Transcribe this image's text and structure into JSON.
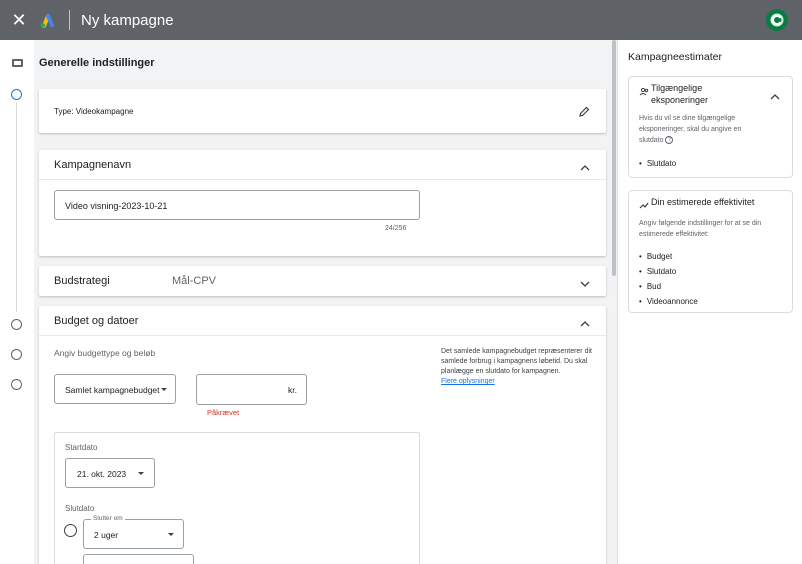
{
  "topbar": {
    "title": "Ny kampagne",
    "close_icon": "close-icon",
    "logo_icon": "google-ads-logo",
    "avatar_icon": "account-avatar"
  },
  "main": {
    "section_title": "Generelle indstillinger",
    "type_card": {
      "label": "Type: Videokampagne",
      "edit_icon": "pencil-icon"
    },
    "name_card": {
      "header": "Kampagnenavn",
      "value": "Video visning-2023-10-21",
      "counter": "24/256"
    },
    "bid_card": {
      "header": "Budstrategi",
      "value": "Mål-CPV"
    },
    "budget_card": {
      "header": "Budget og datoer",
      "prompt": "Angiv budgettype og beløb",
      "budget_type": "Samlet kampagnebudget",
      "amount_value": "",
      "currency": "kr.",
      "error": "Påkrævet",
      "help_text": "Det samlede kampagnebudget repræsenterer dit samlede forbrug i kampagnens løbetid. Du skal planlægge en slutdato for kampagnen.",
      "help_link": "Flere oplysninger",
      "start_label": "Startdato",
      "start_value": "21. okt. 2023",
      "end_label": "Slutdato",
      "ends_in_label": "Slutter om",
      "ends_in_value": "2 uger"
    }
  },
  "aside": {
    "title": "Kampagneestimater",
    "exposures": {
      "title": "Tilgængelige eksponeringer",
      "desc": "Hvis du vil se dine tilgængelige eksponeringer, skal du angive en slutdato",
      "items": [
        "Slutdato"
      ]
    },
    "performance": {
      "title": "Din estimerede effektivitet",
      "desc": "Angiv følgende indstillinger for at se din estimerede effektivitet:",
      "items": [
        "Budget",
        "Slutdato",
        "Bud",
        "Videoannonce"
      ]
    }
  },
  "colors": {
    "topbar": "#5f6368",
    "accent": "#1a73e8",
    "error": "#d93025",
    "link": "#1a73e8"
  }
}
